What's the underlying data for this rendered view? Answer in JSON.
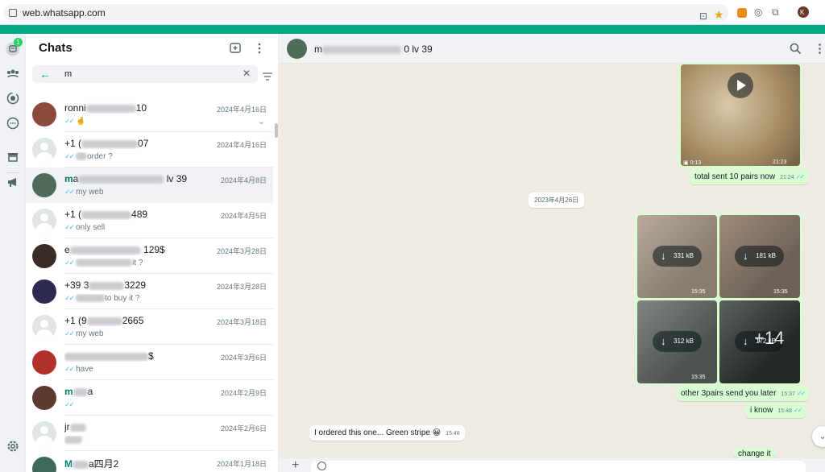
{
  "browser": {
    "url": "web.whatsapp.com",
    "profile_initial": "K"
  },
  "colors": {
    "brand": "#00a884",
    "highlight": "#008069",
    "outgoing_bubble": "#d9fdd3",
    "read_ticks": "#53bdeb"
  },
  "rail": {
    "chats_badge": "1",
    "icons": [
      "chats-icon",
      "communities-icon",
      "status-icon",
      "channels-icon",
      "store-icon",
      "megaphone-icon",
      "settings-icon"
    ]
  },
  "chat_list": {
    "title": "Chats",
    "search": {
      "value": "m",
      "placeholder": "Search"
    },
    "rows": [
      {
        "name_hl": "",
        "name": "ronni",
        "name_tail": "10",
        "date": "2024年4月16日",
        "preview": "🤞",
        "ticks": true
      },
      {
        "name_hl": "",
        "name": "+1 (",
        "name_tail": "07",
        "date": "2024年4月16日",
        "preview": "order ?",
        "ticks": true
      },
      {
        "name_hl": "m",
        "name": "a",
        "name_tail": "lv 39",
        "date": "2024年4月8日",
        "preview": "my web",
        "ticks": true
      },
      {
        "name_hl": "",
        "name": "+1 (",
        "name_tail": "489",
        "date": "2024年4月5日",
        "preview": "only sell",
        "ticks": true
      },
      {
        "name_hl": "",
        "name": "e",
        "name_tail": "129$",
        "date": "2024年3月28日",
        "preview": "it ?",
        "ticks": true
      },
      {
        "name_hl": "",
        "name": "+39 3",
        "name_tail": "3229",
        "date": "2024年3月28日",
        "preview": "to buy it ?",
        "ticks": true
      },
      {
        "name_hl": "",
        "name": "+1 (9",
        "name_tail": "2665",
        "date": "2024年3月18日",
        "preview": "my web",
        "ticks": true
      },
      {
        "name_hl": "",
        "name": "",
        "name_tail": "$",
        "date": "2024年3月6日",
        "preview": "have",
        "ticks": true
      },
      {
        "name_hl": "m",
        "name": "",
        "name_tail": "a",
        "date": "2024年2月9日",
        "preview": "",
        "ticks": true
      },
      {
        "name_hl": "",
        "name": "jr",
        "name_tail": "",
        "date": "2024年2月6日",
        "preview": "",
        "ticks": false
      },
      {
        "name_hl": "M",
        "name": "",
        "name_tail": "a四月2",
        "date": "2024年1月18日",
        "preview": "",
        "ticks": false
      }
    ]
  },
  "conversation": {
    "name_start": "m",
    "name_end": "0 lv 39",
    "video": {
      "duration": "0:13",
      "time": "21:23"
    },
    "messages": {
      "sent_pairs": {
        "text": "total sent 10 pairs now",
        "time": "21:24"
      },
      "date_chip": "2023年4月26日",
      "photos": [
        {
          "size": "331 kB",
          "time": "15:35"
        },
        {
          "size": "181 kB",
          "time": "15:35"
        },
        {
          "size": "312 kB",
          "time": "15:35"
        },
        {
          "size": "172 kB",
          "time": "",
          "overlay": "+14"
        }
      ],
      "other_pairs": {
        "text": "other 3pairs send you later",
        "time": "15:37"
      },
      "i_know": {
        "text": "i know",
        "time": "15:48"
      },
      "ordered": {
        "text": "I ordered this one... Green stripe 😀",
        "time": "15:48"
      },
      "change": {
        "text": "change it"
      }
    }
  }
}
